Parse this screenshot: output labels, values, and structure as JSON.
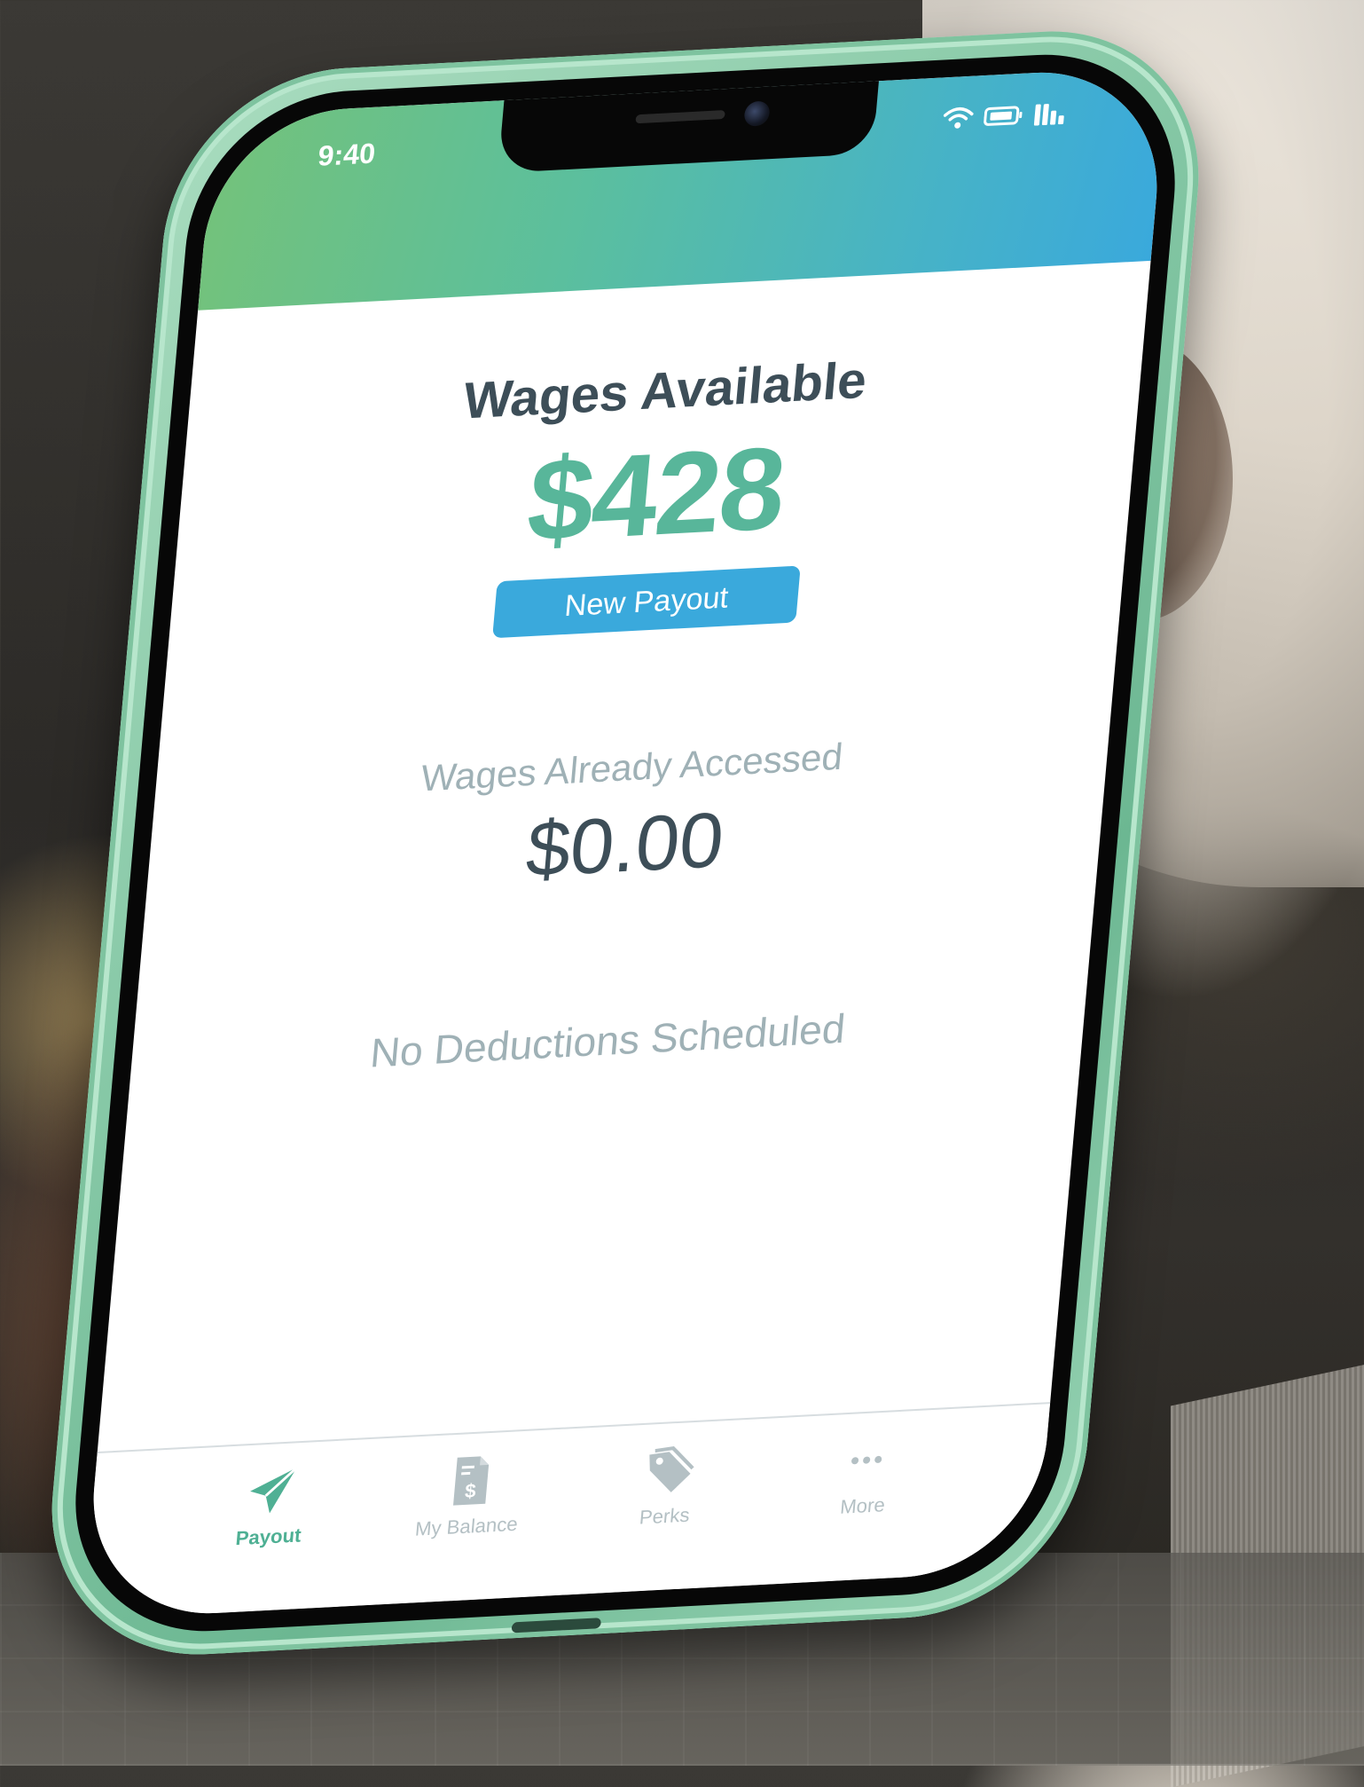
{
  "status_bar": {
    "time": "9:40"
  },
  "wages": {
    "title": "Wages Available",
    "amount": "$428",
    "payout_button": "New Payout"
  },
  "accessed": {
    "label": "Wages Already Accessed",
    "amount": "$0.00"
  },
  "deductions": {
    "text": "No Deductions Scheduled"
  },
  "tabbar": {
    "items": [
      {
        "label": "Payout",
        "icon": "paper-plane-icon",
        "active": true
      },
      {
        "label": "My Balance",
        "icon": "dollar-document-icon",
        "active": false
      },
      {
        "label": "Perks",
        "icon": "tag-icon",
        "active": false
      },
      {
        "label": "More",
        "icon": "more-dots-icon",
        "active": false
      }
    ]
  },
  "colors": {
    "header_gradient_start": "#74c27a",
    "header_gradient_end": "#3aa9dc",
    "accent_green": "#58b69a",
    "button_blue": "#3aa9dc",
    "text_dark": "#3d4e58",
    "text_muted": "#9fb1b6",
    "phone_frame": "#86c8a6"
  }
}
